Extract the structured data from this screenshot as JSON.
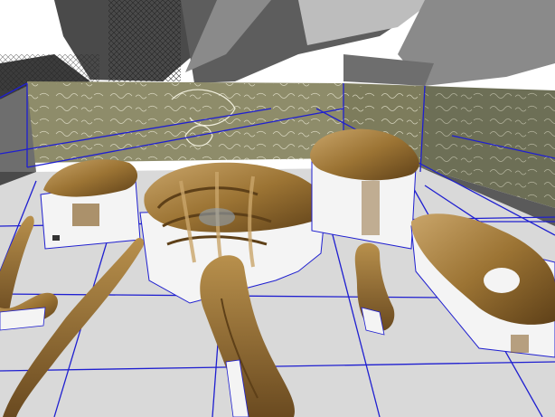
{
  "viewport": {
    "kind": "3d-modeling-viewport",
    "render_style": "textured with blue edge wireframe"
  },
  "colors": {
    "ceiling_dark": "#3c3c3c",
    "ceiling_mid": "#6e6e6e",
    "ceiling_light": "#9a9a9a",
    "wall_panel": "#8e8c6a",
    "wall_panel_right": "#6d6f56",
    "floor": "#d9d9d9",
    "grid_line": "#1f1fd0",
    "bone_dark": "#6a4a20",
    "bone_mid": "#a07838",
    "bone_light": "#c9a56a",
    "block_side": "#f4f4f4"
  },
  "objects": [
    {
      "name": "ribcage-cluster"
    },
    {
      "name": "vertebra-block-left"
    },
    {
      "name": "vertebra-block-top-right"
    },
    {
      "name": "vertebra-block-right"
    },
    {
      "name": "long-bone-center"
    },
    {
      "name": "long-bone-left"
    },
    {
      "name": "rib-left-edge"
    },
    {
      "name": "small-bone-right"
    }
  ],
  "wall_panels": [
    {
      "name": "manuscript-wall-panel-back"
    },
    {
      "name": "manuscript-wall-panel-right"
    }
  ]
}
